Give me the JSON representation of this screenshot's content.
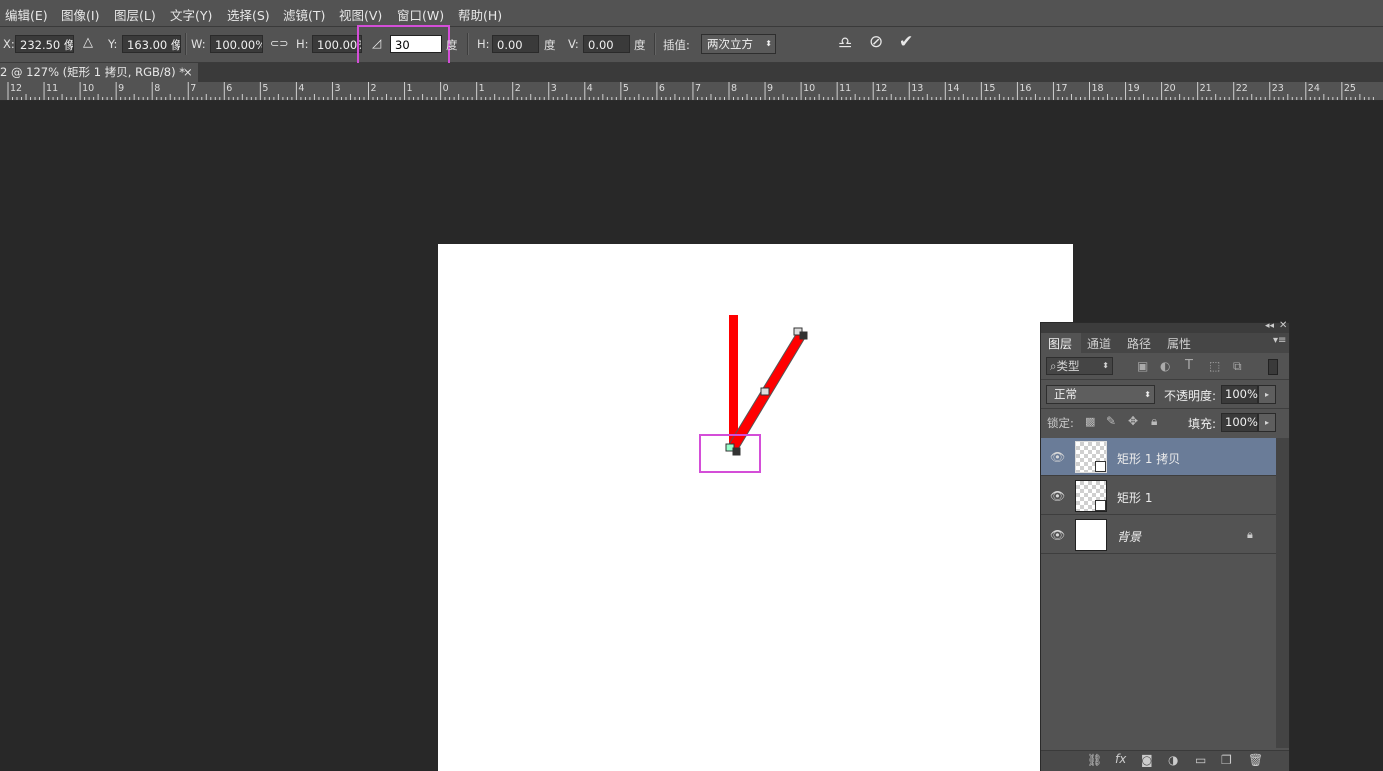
{
  "menu": [
    "编辑(E)",
    "图像(I)",
    "图层(L)",
    "文字(Y)",
    "选择(S)",
    "滤镜(T)",
    "视图(V)",
    "窗口(W)",
    "帮助(H)"
  ],
  "options": {
    "x_label": "X:",
    "x_value": "232.50 像素",
    "y_label": "Y:",
    "y_value": "163.00 像素",
    "w_label": "W:",
    "w_value": "100.00%",
    "h_label": "H:",
    "h_value": "100.00%",
    "angle_value": "30",
    "angle_unit": "度",
    "skew_h_label": "H:",
    "skew_h_value": "0.00",
    "skew_h_unit": "度",
    "skew_v_label": "V:",
    "skew_v_value": "0.00",
    "skew_v_unit": "度",
    "interp_label": "插值:",
    "interp_value": "两次立方"
  },
  "doc_tab": {
    "title": "2 @ 127% (矩形 1 拷贝, RGB/8) *",
    "close": "×"
  },
  "ruler_numbers": [
    "12",
    "11",
    "10",
    "9",
    "8",
    "7",
    "6",
    "5",
    "4",
    "3",
    "2",
    "1",
    "0",
    "1",
    "2",
    "3",
    "4",
    "5",
    "6",
    "7",
    "8",
    "9",
    "10",
    "11",
    "12",
    "13",
    "14",
    "15",
    "16",
    "17",
    "18",
    "19",
    "20",
    "21",
    "22",
    "23",
    "24",
    "25"
  ],
  "layers_panel": {
    "tabs": [
      "图层",
      "通道",
      "路径",
      "属性"
    ],
    "filter_label": "类型",
    "blend_mode": "正常",
    "opacity_label": "不透明度:",
    "opacity_value": "100%",
    "lock_label": "锁定:",
    "fill_label": "填充:",
    "fill_value": "100%",
    "layers": [
      {
        "name": "矩形 1 拷贝",
        "selected": true
      },
      {
        "name": "矩形 1",
        "selected": false
      },
      {
        "name": "背景",
        "selected": false,
        "locked": true
      }
    ]
  },
  "colors": {
    "highlight": "#d44ed8",
    "shape": "#ff0000",
    "selected_layer": "#6a7c98"
  }
}
